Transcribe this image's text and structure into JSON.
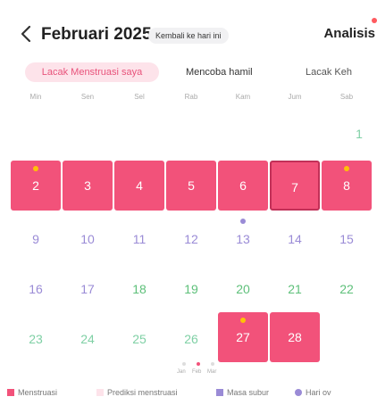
{
  "header": {
    "month_title": "Februari 2025",
    "today_button": "Kembali ke hari ini",
    "analysis": "Analisis"
  },
  "tabs": [
    "Lacak Menstruasi saya",
    "Mencoba hamil",
    "Lacak Keh"
  ],
  "weekdays": [
    "Min",
    "Sen",
    "Sel",
    "Rab",
    "Kam",
    "Jum",
    "Sab"
  ],
  "calendar": {
    "week1": [
      "1"
    ],
    "week2": [
      "2",
      "3",
      "4",
      "5",
      "6",
      "7",
      "8"
    ],
    "week3": [
      "9",
      "10",
      "11",
      "12",
      "13",
      "14",
      "15"
    ],
    "week4": [
      "16",
      "17",
      "18",
      "19",
      "20",
      "21",
      "22"
    ],
    "week5": [
      "23",
      "24",
      "25",
      "26",
      "27",
      "28"
    ]
  },
  "pager": [
    "Jan",
    "Feb",
    "Mar"
  ],
  "legend": [
    "Menstruasi",
    "Prediksi menstruasi",
    "Masa subur",
    "Hari ov"
  ],
  "colors": {
    "period": "#f2527a",
    "predicted": "#fde3ea",
    "fertile": "#9a8bd6",
    "ovulation_marker": "#ffc107"
  }
}
